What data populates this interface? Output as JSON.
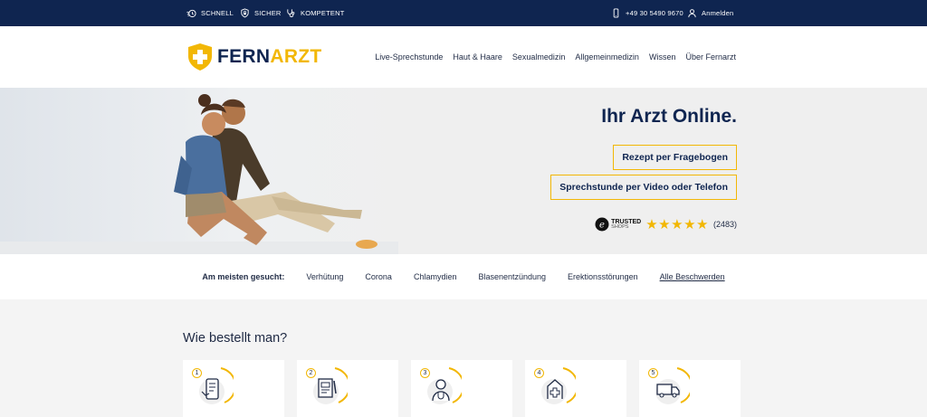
{
  "topbar": {
    "features": [
      {
        "label": "SCHNELL",
        "icon": "stopwatch-icon"
      },
      {
        "label": "SICHER",
        "icon": "shield-lock-icon"
      },
      {
        "label": "KOMPETENT",
        "icon": "stethoscope-icon"
      }
    ],
    "phone": "+49 30 5490 9670",
    "login": "Anmelden"
  },
  "header": {
    "logo_part1": "FERN",
    "logo_part2": "ARZT",
    "nav": [
      "Live-Sprechstunde",
      "Haut & Haare",
      "Sexualmedizin",
      "Allgemeinmedizin",
      "Wissen",
      "Über Fernarzt"
    ]
  },
  "hero": {
    "title": "Ihr Arzt Online.",
    "button_prescription": "Rezept per Fragebogen",
    "button_consultation": "Sprechstunde per Video oder Telefon",
    "trust_brand": "TRUSTED",
    "trust_sub": "SHOPS",
    "rating_stars": 5,
    "rating_count": "(2483)"
  },
  "search": {
    "label": "Am meisten gesucht:",
    "items": [
      "Verhütung",
      "Corona",
      "Chlamydien",
      "Blasenentzündung",
      "Erektionsstörungen"
    ],
    "all_link": "Alle Beschwerden"
  },
  "order": {
    "title": "Wie bestellt man?",
    "steps": [
      {
        "num": "1",
        "icon": "smartphone-form-icon"
      },
      {
        "num": "2",
        "icon": "prescription-doc-icon"
      },
      {
        "num": "3",
        "icon": "doctor-icon"
      },
      {
        "num": "4",
        "icon": "pharmacy-icon"
      },
      {
        "num": "5",
        "icon": "delivery-truck-icon"
      }
    ]
  },
  "colors": {
    "navy": "#0f2550",
    "accent": "#f2b705"
  }
}
